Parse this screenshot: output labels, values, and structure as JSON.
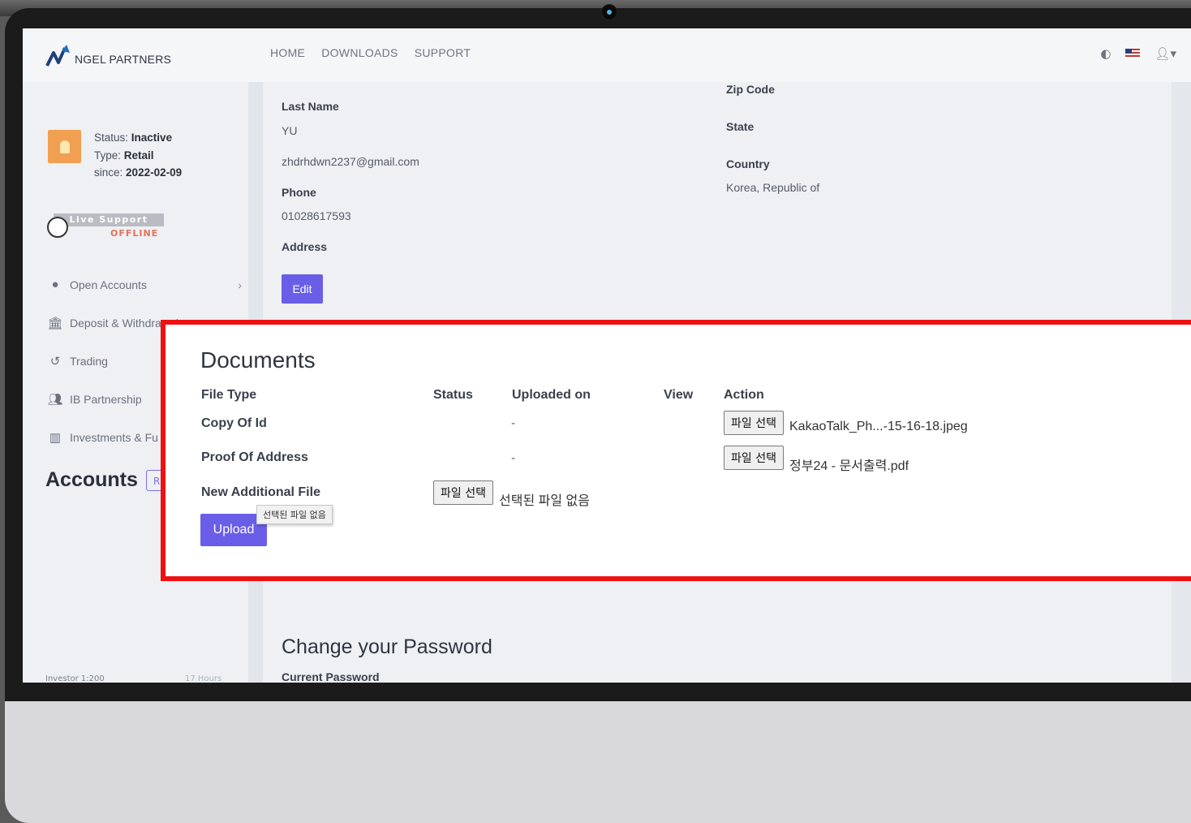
{
  "brand": {
    "name": "NGEL PARTNERS"
  },
  "nav": {
    "home": "HOME",
    "downloads": "DOWNLOADS",
    "support": "SUPPORT"
  },
  "header_icons": {
    "theme": "contrast-icon",
    "language": "us-flag-icon",
    "user": "user-menu-icon"
  },
  "profile": {
    "status_label": "Status:",
    "status_value": "Inactive",
    "type_label": "Type:",
    "type_value": "Retail",
    "since_label": "since:",
    "since_value": "2022-02-09"
  },
  "live_support": {
    "label": "Live Support",
    "state": "OFFLINE"
  },
  "sidebar": {
    "items": [
      {
        "label": "Open Accounts",
        "icon": "play-circle-icon"
      },
      {
        "label": "Deposit & Withdrawal",
        "icon": "bank-icon"
      },
      {
        "label": "Trading",
        "icon": "history-icon"
      },
      {
        "label": "IB Partnership",
        "icon": "users-icon"
      },
      {
        "label": "Investments & Fu",
        "icon": "bar-chart-icon"
      }
    ],
    "accounts_title": "Accounts",
    "accounts_button": "R",
    "footer_left": "Investor 1:200",
    "footer_right": "17 Hours"
  },
  "profile_form": {
    "last_name_label": "Last Name",
    "last_name_value": "YU",
    "email_value": "zhdrhdwn2237@gmail.com",
    "phone_label": "Phone",
    "phone_value": "01028617593",
    "address_label": "Address",
    "zip_label": "Zip Code",
    "state_label": "State",
    "country_label": "Country",
    "country_value": "Korea, Republic of",
    "edit_button": "Edit"
  },
  "documents": {
    "title": "Documents",
    "headers": {
      "file_type": "File Type",
      "status": "Status",
      "uploaded_on": "Uploaded on",
      "view": "View",
      "action": "Action"
    },
    "rows": [
      {
        "file_type": "Copy Of Id",
        "uploaded_on": "-",
        "button": "파일 선택",
        "file_name": "KakaoTalk_Ph...-15-16-18.jpeg"
      },
      {
        "file_type": "Proof Of Address",
        "uploaded_on": "-",
        "button": "파일 선택",
        "file_name": "정부24 - 문서출력.pdf"
      }
    ],
    "new_file": {
      "label": "New Additional File",
      "button": "파일 선택",
      "file_name": "선택된 파일 없음"
    },
    "upload_button": "Upload",
    "tooltip": "선택된 파일 없음"
  },
  "password": {
    "title": "Change your Password",
    "current_label": "Current Password",
    "current_value": ""
  }
}
